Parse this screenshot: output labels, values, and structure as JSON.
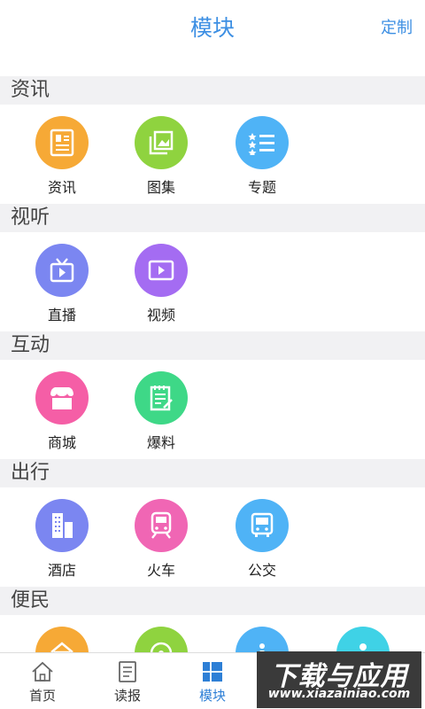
{
  "header": {
    "title": "模块",
    "action_label": "定制"
  },
  "sections": [
    {
      "title": "资讯",
      "items": [
        {
          "label": "资讯",
          "icon": "news-document-icon",
          "color": "#f6a936"
        },
        {
          "label": "图集",
          "icon": "gallery-icon",
          "color": "#8fd33f"
        },
        {
          "label": "专题",
          "icon": "topic-list-icon",
          "color": "#4fb3f6"
        }
      ]
    },
    {
      "title": "视听",
      "items": [
        {
          "label": "直播",
          "icon": "live-tv-icon",
          "color": "#7b86f1"
        },
        {
          "label": "视频",
          "icon": "video-play-icon",
          "color": "#a46cf2"
        }
      ]
    },
    {
      "title": "互动",
      "items": [
        {
          "label": "商城",
          "icon": "shop-icon",
          "color": "#f55ea6"
        },
        {
          "label": "爆料",
          "icon": "report-edit-icon",
          "color": "#3ed887"
        }
      ]
    },
    {
      "title": "出行",
      "items": [
        {
          "label": "酒店",
          "icon": "hotel-building-icon",
          "color": "#7b86f1"
        },
        {
          "label": "火车",
          "icon": "train-icon",
          "color": "#f066b4"
        },
        {
          "label": "公交",
          "icon": "bus-icon",
          "color": "#4fb3f6"
        }
      ]
    },
    {
      "title": "便民",
      "items": [
        {
          "label": "",
          "icon": "home-service-icon",
          "color": "#f6a936"
        },
        {
          "label": "",
          "icon": "location-icon",
          "color": "#8fd33f"
        },
        {
          "label": "",
          "icon": "info-icon",
          "color": "#4fb3f6"
        },
        {
          "label": "",
          "icon": "person-info-icon",
          "color": "#3fd2e6"
        }
      ]
    }
  ],
  "tabs": [
    {
      "label": "首页",
      "icon": "home-icon",
      "active": false
    },
    {
      "label": "读报",
      "icon": "newspaper-icon",
      "active": false
    },
    {
      "label": "模块",
      "icon": "modules-grid-icon",
      "active": true
    }
  ],
  "watermark": {
    "title": "下载与应用",
    "url": "www.xiazainiao.com"
  },
  "colors": {
    "accent": "#3d8fe3",
    "section_bg": "#f1f1f3",
    "tab_active": "#2d7fd6"
  }
}
